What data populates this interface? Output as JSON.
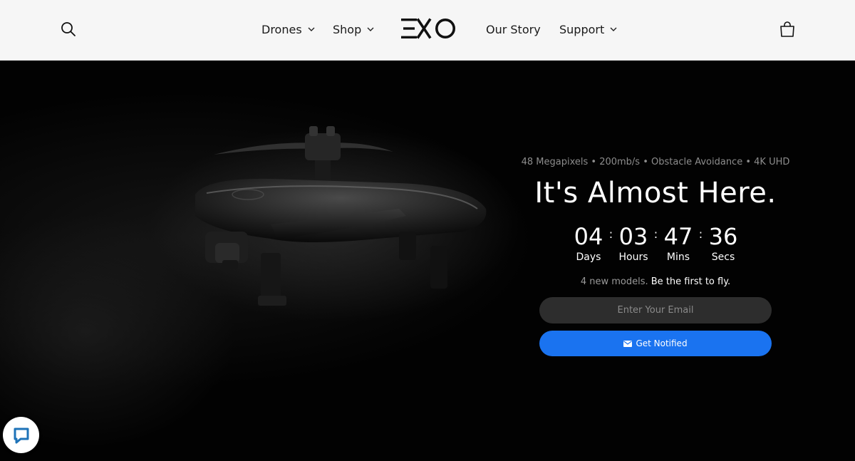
{
  "header": {
    "nav": [
      {
        "label": "Drones",
        "has_dropdown": true
      },
      {
        "label": "Shop",
        "has_dropdown": true
      },
      {
        "label": "Our Story",
        "has_dropdown": false
      },
      {
        "label": "Support",
        "has_dropdown": true
      }
    ],
    "logo_text": "EXO",
    "icons": {
      "search": "search-icon",
      "cart": "cart-icon",
      "chevron": "chevron-down-icon"
    }
  },
  "hero": {
    "tagline": "48 Megapixels • 200mb/s • Obstacle Avoidance • 4K UHD",
    "headline": "It's Almost Here.",
    "countdown": [
      {
        "value": "04",
        "label": "Days"
      },
      {
        "value": "03",
        "label": "Hours"
      },
      {
        "value": "47",
        "label": "Mins"
      },
      {
        "value": "36",
        "label": "Secs"
      }
    ],
    "separator": ":",
    "subline_muted": "4 new models.",
    "subline_strong": "Be the first to fly.",
    "email_placeholder": "Enter Your Email",
    "email_value": "",
    "button_label": "Get Notified",
    "button_icon": "envelope-icon"
  },
  "chat": {
    "icon": "chat-icon"
  },
  "colors": {
    "header_bg": "#f6f6f6",
    "hero_bg": "#000000",
    "accent": "#1a73f0",
    "input_bg": "#2d2d2d",
    "text_muted": "#8d8d8d"
  }
}
